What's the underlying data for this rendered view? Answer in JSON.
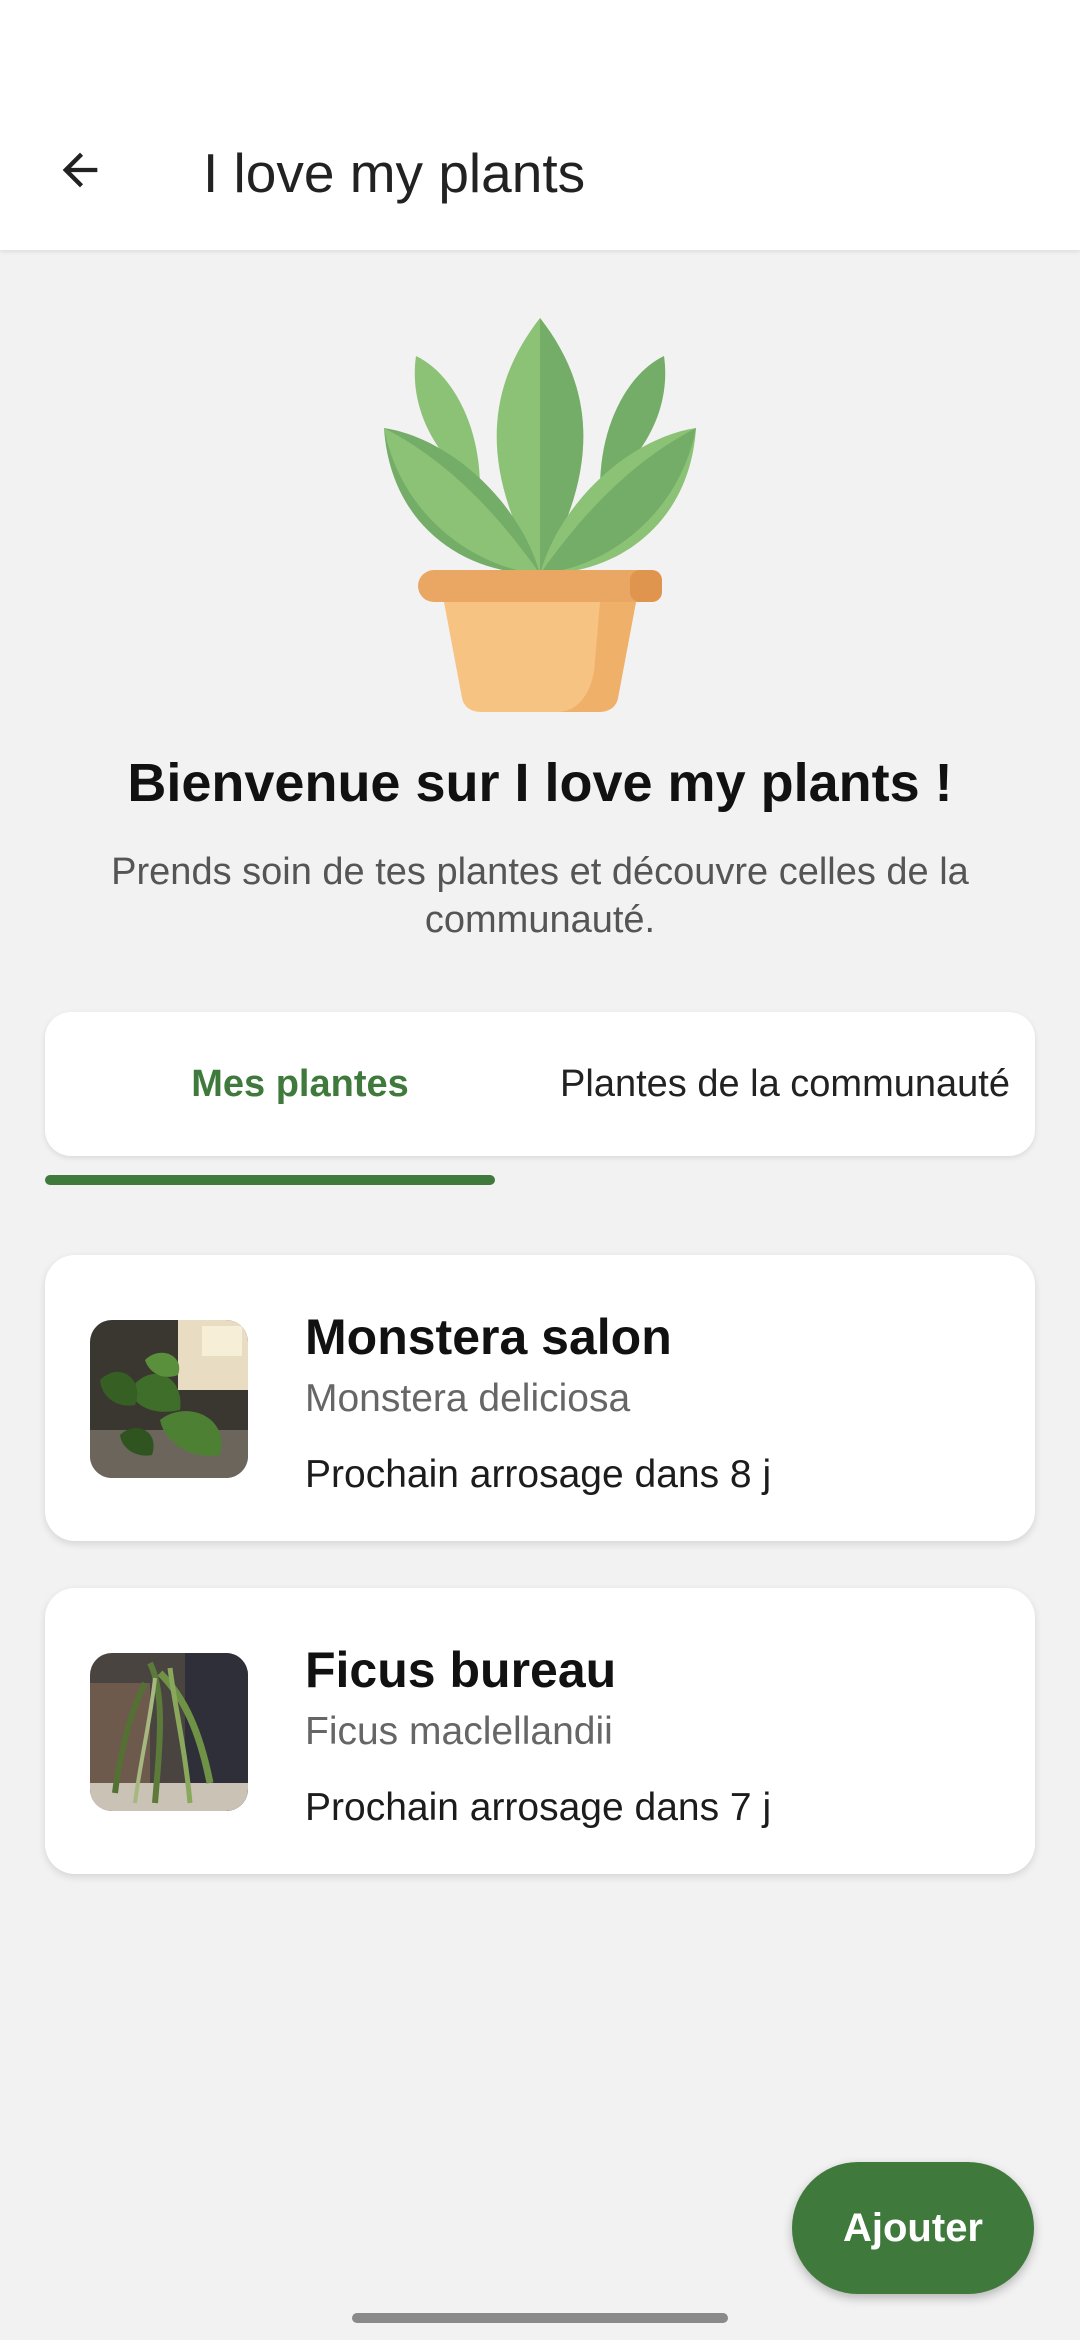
{
  "appbar": {
    "title": "I love my plants",
    "back_icon": "arrow-left-icon"
  },
  "hero": {
    "illustration": "potted-plant-illustration",
    "title": "Bienvenue sur I love my plants !",
    "subtitle": "Prends soin de tes plantes et découvre celles de la communauté."
  },
  "tabs": [
    {
      "label": "Mes plantes",
      "selected": true
    },
    {
      "label": "Plantes de la communauté",
      "selected": false
    }
  ],
  "plants": [
    {
      "name": "Monstera salon",
      "species": "Monstera deliciosa",
      "watering": "Prochain arrosage dans 8 j"
    },
    {
      "name": "Ficus bureau",
      "species": "Ficus maclellandii",
      "watering": "Prochain arrosage dans 7 j"
    }
  ],
  "fab": {
    "label": "Ajouter"
  },
  "colors": {
    "accent": "#3f7a3c",
    "background": "#f2f2f2",
    "surface": "#ffffff",
    "leaf_light": "#8cc276",
    "leaf_dark": "#74ad68",
    "pot": "#f6c383",
    "pot_rim": "#e9a763"
  }
}
